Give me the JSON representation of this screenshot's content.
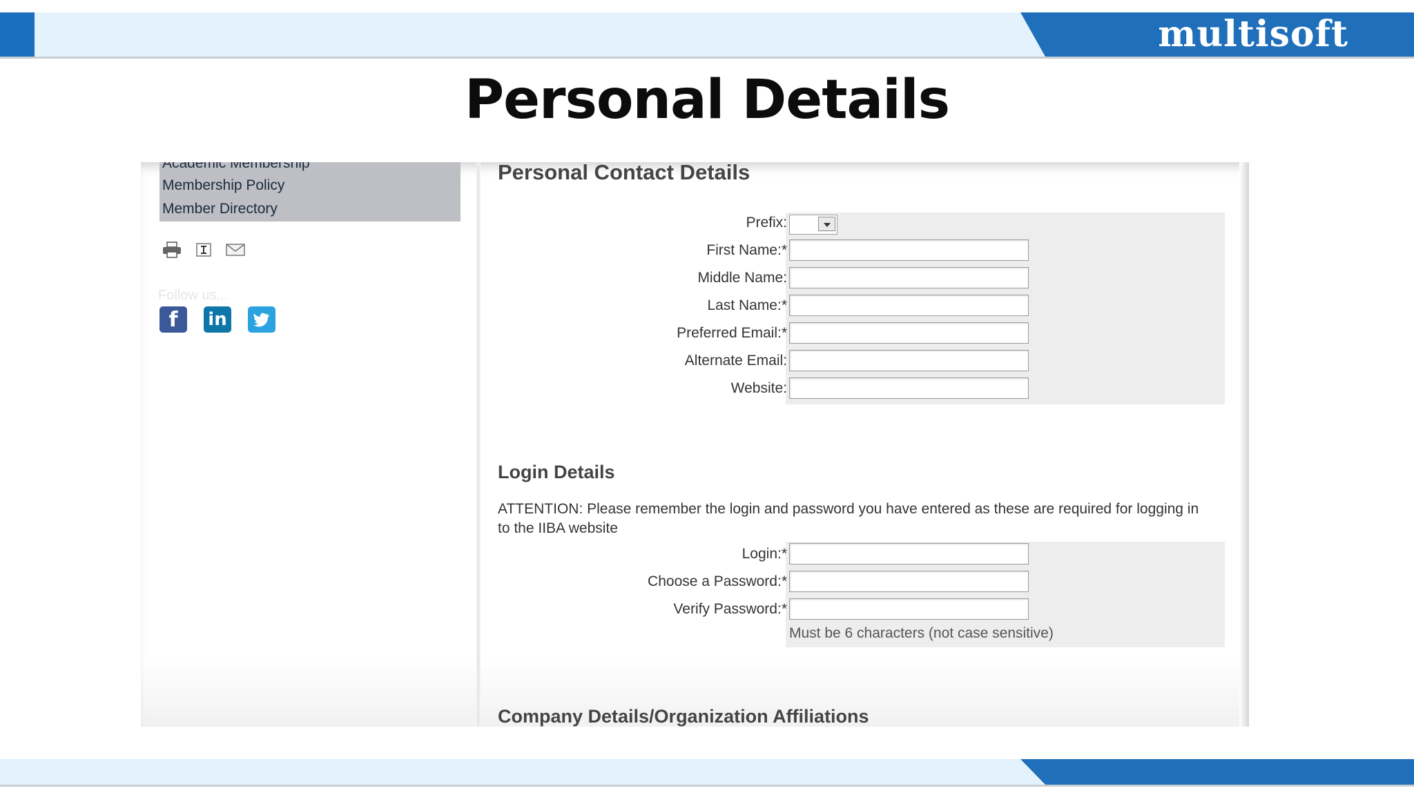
{
  "brand": {
    "name": "multisoft"
  },
  "slide": {
    "title": "Personal Details"
  },
  "sidebar": {
    "items": [
      "Academic Membership",
      "Membership Policy",
      "Member Directory"
    ],
    "follow_label": "Follow us..."
  },
  "contact": {
    "title": "Personal Contact Details",
    "fields": [
      {
        "label": "Prefix:",
        "type": "select",
        "value": ""
      },
      {
        "label": "First Name:*",
        "type": "text",
        "value": ""
      },
      {
        "label": "Middle Name:",
        "type": "text",
        "value": ""
      },
      {
        "label": "Last Name:*",
        "type": "text",
        "value": ""
      },
      {
        "label": "Preferred Email:*",
        "type": "text",
        "value": ""
      },
      {
        "label": "Alternate Email:",
        "type": "text",
        "value": ""
      },
      {
        "label": "Website:",
        "type": "text",
        "value": ""
      }
    ]
  },
  "login": {
    "title": "Login Details",
    "attention": "ATTENTION: Please remember the login and password you have entered as these are required for logging in to the IIBA website",
    "fields": [
      {
        "label": "Login:*",
        "value": ""
      },
      {
        "label": "Choose a Password:*",
        "value": ""
      },
      {
        "label": "Verify Password:*",
        "value": ""
      }
    ],
    "hint": "Must be 6 characters (not case sensitive)"
  },
  "company": {
    "title": "Company Details/Organization Affiliations"
  },
  "colors": {
    "brand_blue": "#1f6fba",
    "band_light": "#e3f2fc"
  },
  "icons": [
    "print-icon",
    "text-size-icon",
    "email-icon",
    "facebook-icon",
    "linkedin-icon",
    "twitter-icon"
  ]
}
